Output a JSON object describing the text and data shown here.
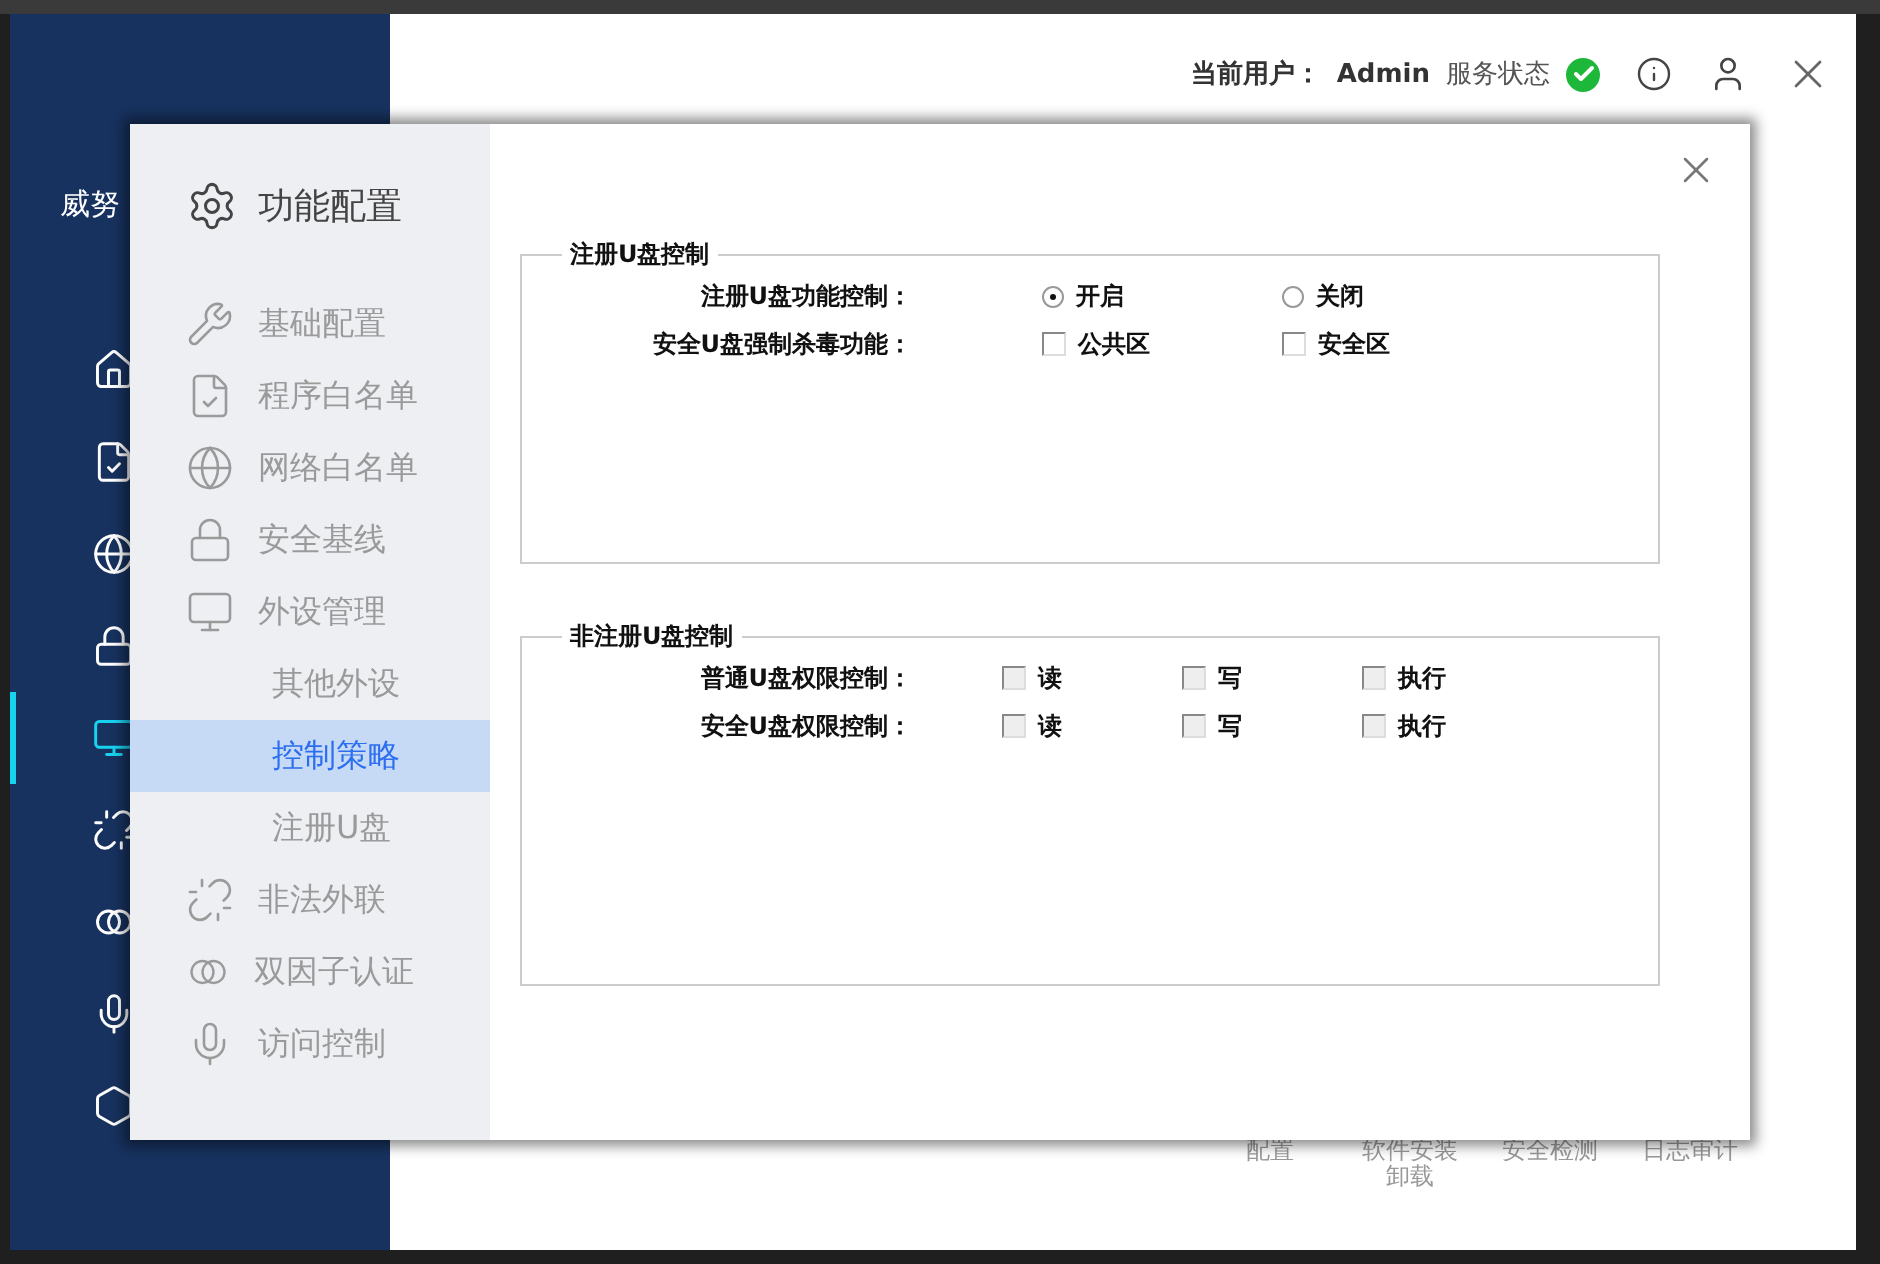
{
  "app": {
    "brand": "威努",
    "user_label": "当前用户：",
    "user": "Admin",
    "service_label": "服务状态",
    "service_ok": true,
    "nav": [
      {
        "selected": false
      },
      {
        "selected": false
      },
      {
        "selected": false
      },
      {
        "selected": false
      },
      {
        "selected": true
      },
      {
        "selected": false
      },
      {
        "selected": false
      },
      {
        "selected": false
      },
      {
        "selected": false
      }
    ],
    "shortcuts": [
      "配置",
      "软件安装卸载",
      "安全检测",
      "日志审计"
    ]
  },
  "dialog": {
    "title": "功能配置",
    "menu": [
      {
        "label": "基础配置",
        "selected": false
      },
      {
        "label": "程序白名单",
        "selected": false
      },
      {
        "label": "网络白名单",
        "selected": false
      },
      {
        "label": "安全基线",
        "selected": false
      },
      {
        "label": "外设管理",
        "selected": false,
        "children": [
          {
            "label": "其他外设",
            "selected": false
          },
          {
            "label": "控制策略",
            "selected": true
          },
          {
            "label": "注册U盘",
            "selected": false
          }
        ]
      },
      {
        "label": "非法外联",
        "selected": false
      },
      {
        "label": "双因子认证",
        "selected": false
      },
      {
        "label": "访问控制",
        "selected": false
      }
    ],
    "sections": [
      {
        "title": "注册U盘控制",
        "rows": [
          {
            "label": "注册U盘功能控制：",
            "kind": "radio",
            "options": [
              {
                "label": "开启",
                "selected": true
              },
              {
                "label": "关闭",
                "selected": false
              }
            ]
          },
          {
            "label": "安全U盘强制杀毒功能：",
            "kind": "checkbox",
            "options": [
              {
                "label": "公共区",
                "checked": false,
                "disabled": false
              },
              {
                "label": "安全区",
                "checked": false,
                "disabled": false
              }
            ]
          }
        ]
      },
      {
        "title": "非注册U盘控制",
        "rows": [
          {
            "label": "普通U盘权限控制：",
            "kind": "checkbox",
            "options": [
              {
                "label": "读",
                "checked": false,
                "disabled": true
              },
              {
                "label": "写",
                "checked": false,
                "disabled": true
              },
              {
                "label": "执行",
                "checked": false,
                "disabled": true
              }
            ]
          },
          {
            "label": "安全U盘权限控制：",
            "kind": "checkbox",
            "options": [
              {
                "label": "读",
                "checked": false,
                "disabled": true
              },
              {
                "label": "写",
                "checked": false,
                "disabled": true
              },
              {
                "label": "执行",
                "checked": false,
                "disabled": true
              }
            ]
          }
        ]
      }
    ]
  }
}
